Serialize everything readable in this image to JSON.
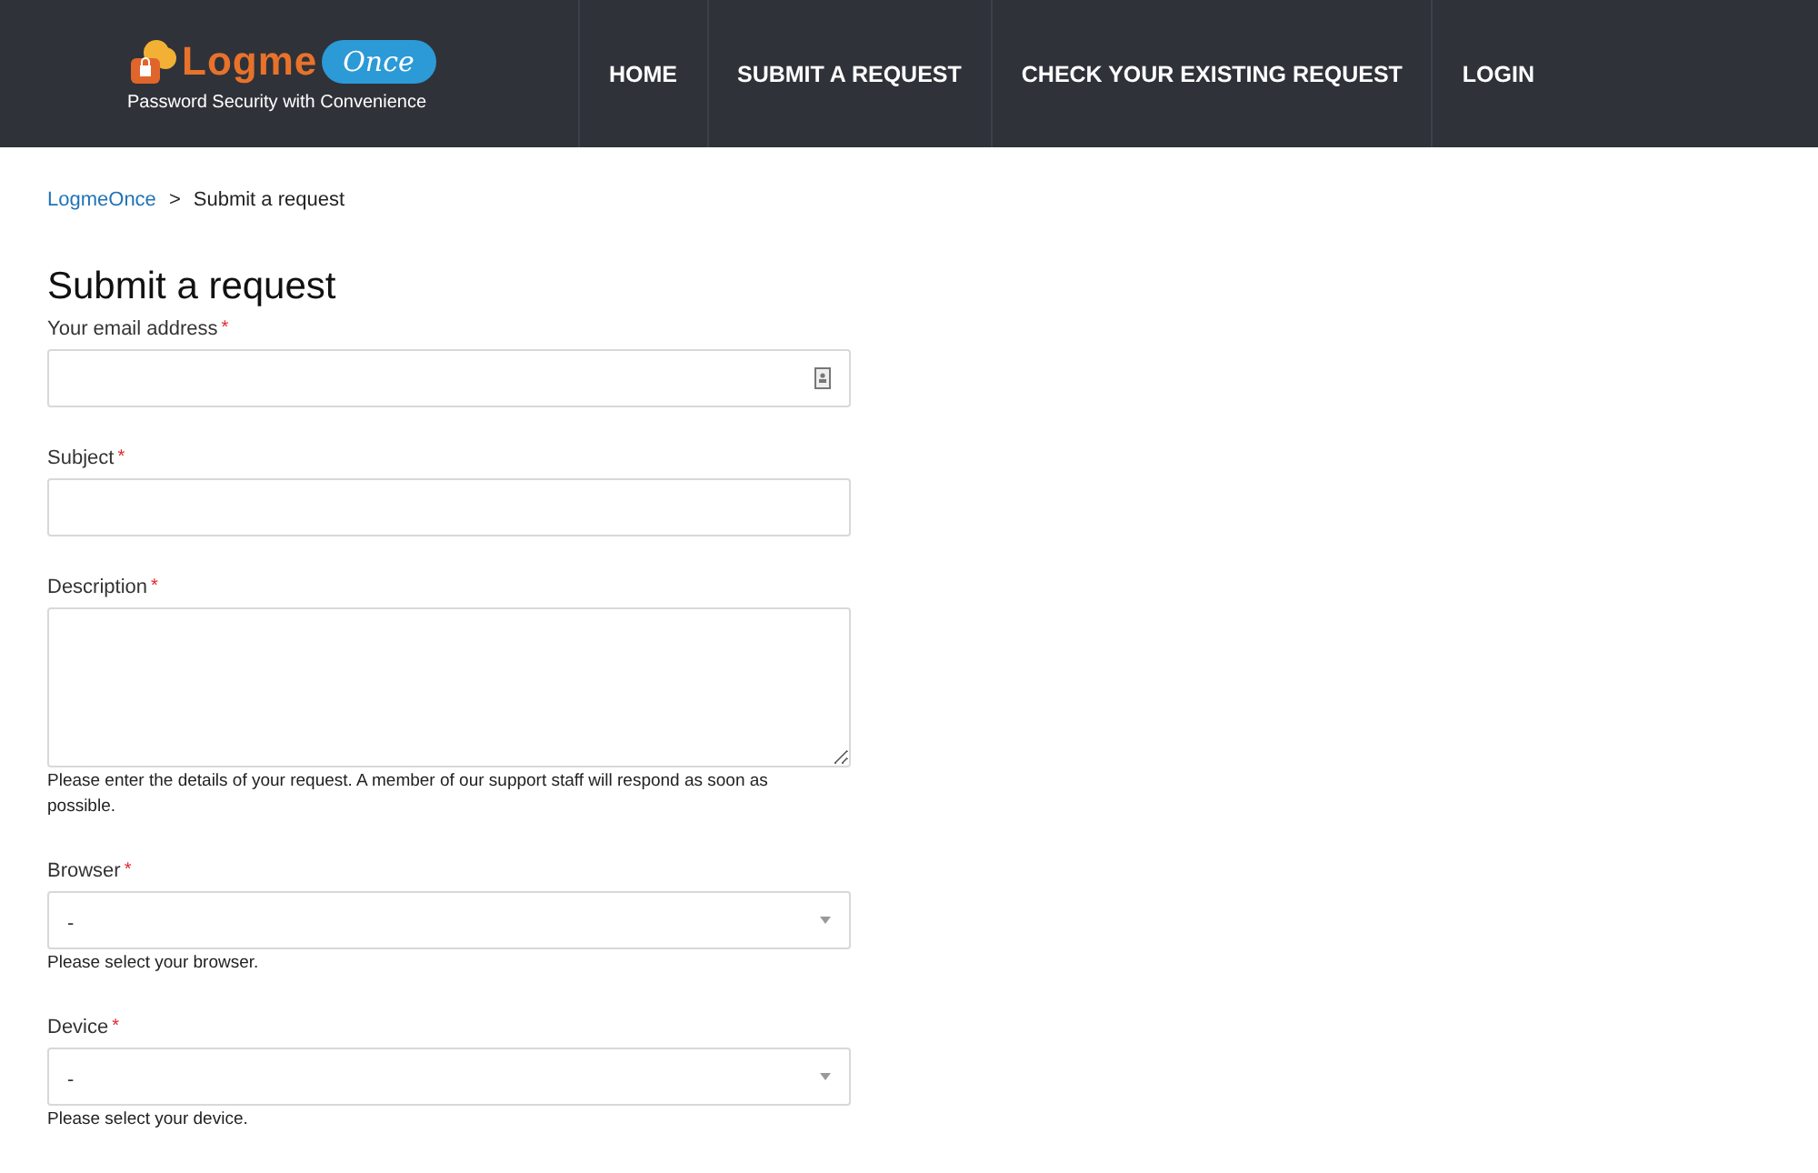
{
  "header": {
    "logo": {
      "word_1": "Logme",
      "word_2": "Once",
      "tagline": "Password Security with Convenience"
    },
    "nav": [
      {
        "label": "HOME"
      },
      {
        "label": "SUBMIT A REQUEST"
      },
      {
        "label": "CHECK YOUR EXISTING REQUEST"
      },
      {
        "label": "LOGIN"
      }
    ]
  },
  "breadcrumbs": {
    "items": [
      "LogmeOnce",
      "Submit a request"
    ],
    "separator": ">"
  },
  "title": "Submit a request",
  "fields": [
    {
      "kind": "text",
      "label": "Your email address",
      "required_mark": "*",
      "autofill_icon": true
    },
    {
      "kind": "text",
      "label": "Subject",
      "required_mark": "*",
      "autofill_icon": false
    },
    {
      "kind": "textarea",
      "label": "Description",
      "required_mark": "*",
      "hint": "Please enter the details of your request. A member of our support staff will respond as soon as possible."
    },
    {
      "kind": "select",
      "label": "Browser",
      "required_mark": "*",
      "value": "-",
      "hint": "Please select your browser."
    },
    {
      "kind": "select",
      "label": "Device",
      "required_mark": "*",
      "value": "-",
      "hint": "Please select your device."
    }
  ]
}
